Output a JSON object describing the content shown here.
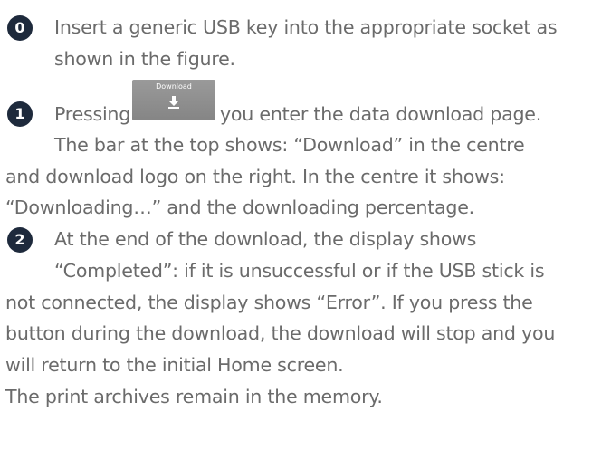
{
  "steps": [
    {
      "number": "0",
      "lines": [
        "Insert a generic USB key into the appropriate socket as",
        "shown in the figure."
      ]
    },
    {
      "number": "1",
      "prefix": "Pressing",
      "suffix": "you enter the data download page.",
      "lines": [
        "The bar at the top shows: “Download” in the centre",
        "and download logo on the right. In the centre it shows:",
        "“Downloading…” and the downloading percentage."
      ]
    },
    {
      "number": "2",
      "lines": [
        "At the end of the download, the display shows",
        "“Completed”: if it is unsuccessful or if the USB stick is",
        "not connected, the display shows “Error”. If you press the",
        "button during the download, the download will stop and you",
        "will return to the initial Home screen.",
        "The print archives remain in the memory."
      ]
    }
  ],
  "download_button": {
    "label": "Download",
    "icon": "download-arrow-icon"
  },
  "colors": {
    "text": "#6b6b6b",
    "badge": "#1e2a3c",
    "button": "#8e8e8e"
  }
}
